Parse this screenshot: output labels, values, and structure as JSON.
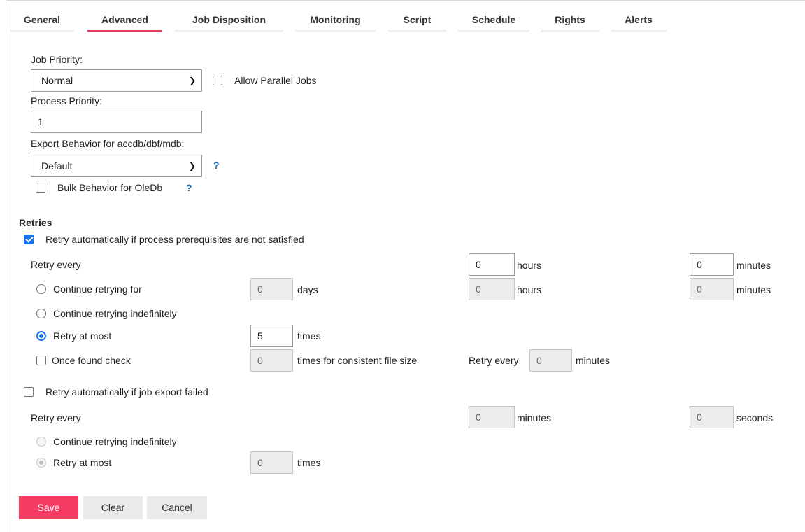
{
  "tabs": [
    "General",
    "Advanced",
    "Job Disposition",
    "Monitoring",
    "Script",
    "Schedule",
    "Rights",
    "Alerts"
  ],
  "active_tab": "Advanced",
  "colors": {
    "accent": "#e9415f",
    "save_button": "#f53b61",
    "checkbox": "#1a73e8",
    "help": "#1f6fb5"
  },
  "general": {
    "job_priority_label": "Job Priority:",
    "job_priority_value": "Normal",
    "allow_parallel_label": "Allow Parallel Jobs",
    "allow_parallel_checked": false,
    "process_priority_label": "Process Priority:",
    "process_priority_value": "1",
    "export_behavior_label": "Export Behavior for accdb/dbf/mdb:",
    "export_behavior_value": "Default",
    "help_mark": "?",
    "bulk_behavior_label": "Bulk Behavior for OleDb",
    "bulk_behavior_checked": false
  },
  "retries": {
    "title": "Retries",
    "prereq_label": "Retry automatically if process prerequisites are not satisfied",
    "prereq_checked": true,
    "retry_every_label": "Retry every",
    "retry_every_hours": "0",
    "hours_unit": "hours",
    "retry_every_minutes": "0",
    "minutes_unit": "minutes",
    "continue_for_label": "Continue retrying for",
    "continue_days": "0",
    "days_unit": "days",
    "continue_hours": "0",
    "continue_minutes": "0",
    "indefinitely_label": "Continue retrying indefinitely",
    "at_most_label": "Retry at most",
    "at_most_value": "5",
    "times_unit": "times",
    "once_found_label": "Once found check",
    "once_found_value": "0",
    "consistent_unit": "times for consistent file size",
    "once_retry_every_label": "Retry every",
    "once_retry_every_value": "0",
    "export_label": "Retry automatically if job export failed",
    "export_checked": false,
    "export_retry_every_label": "Retry every",
    "export_minutes_value": "0",
    "export_minutes_unit": "minutes",
    "export_seconds_value": "0",
    "export_seconds_unit": "seconds",
    "export_indefinitely_label": "Continue retrying indefinitely",
    "export_at_most_label": "Retry at most",
    "export_at_most_value": "0",
    "export_times_unit": "times"
  },
  "buttons": {
    "save": "Save",
    "clear": "Clear",
    "cancel": "Cancel"
  }
}
